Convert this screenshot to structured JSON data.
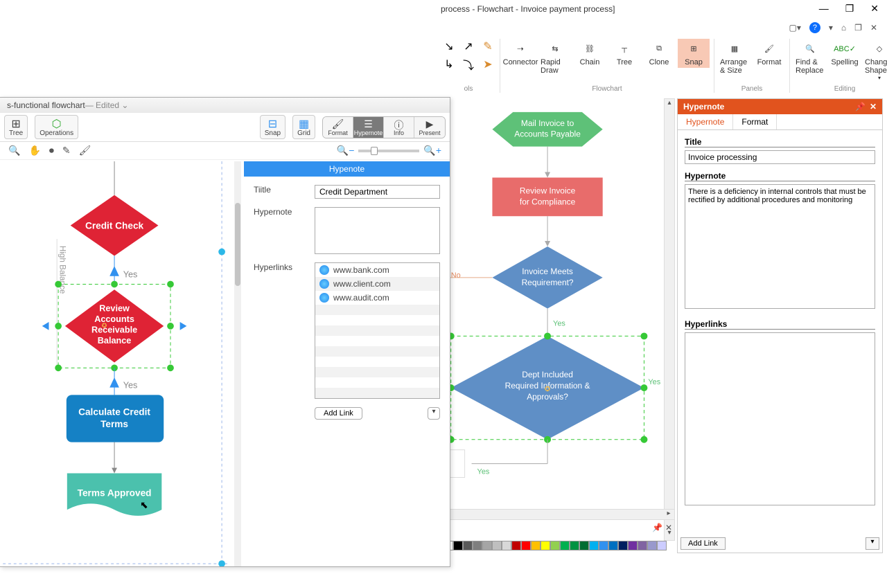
{
  "window": {
    "title": "process - Flowchart - Invoice payment process]",
    "controls": {
      "min": "—",
      "max": "❐",
      "close": "✕"
    },
    "quick": {
      "dd": "▾",
      "help": "?",
      "aux1": "▾",
      "aux2": "⌂",
      "aux3": "❐",
      "aux4": "✕"
    }
  },
  "ribbon": {
    "group1_label": "ols",
    "connector": "Connector",
    "rapid": "Rapid Draw",
    "chain": "Chain",
    "tree": "Tree",
    "clone": "Clone",
    "snap": "Snap",
    "flowchart_label": "Flowchart",
    "arrange": "Arrange & Size",
    "format": "Format",
    "panels_label": "Panels",
    "find": "Find & Replace",
    "spelling": "Spelling",
    "change_shape": "Change Shape",
    "editing_label": "Editing"
  },
  "hypernote_panel": {
    "header": "Hypernote",
    "tabs": {
      "hypernote": "Hypernote",
      "format": "Format"
    },
    "title_label": "Title",
    "title_value": "Invoice processing",
    "note_label": "Hypernote",
    "note_value": "There is a deficiency in internal controls that must be rectified by additional procedures and monitoring",
    "links_label": "Hyperlinks",
    "add_link": "Add Link"
  },
  "center_flow": {
    "node1": "Mail Invoice to Accounts Payable",
    "node2": "Review Invoice for Compliance",
    "node3": "Invoice Meets Requirement?",
    "node4": "Dept Included Required Information & Approvals?",
    "edge_no": "No",
    "edge_yes": "Yes",
    "edge_yes2": "Yes",
    "edge_yes3": "Yes"
  },
  "mac": {
    "doc_title": "s-functional flowchart",
    "edited": " — Edited",
    "tree": "Tree",
    "operations": "Operations",
    "snap": "Snap",
    "grid": "Grid",
    "seg_format": "Format",
    "seg_hypernote": "Hypernote",
    "seg_info": "Info",
    "seg_present": "Present",
    "inspector": {
      "header": "Hypenote",
      "title_label": "Tiitle",
      "title_value": "Credit Department",
      "note_label": "Hypernote",
      "links_label": "Hyperlinks",
      "link1": "www.bank.com",
      "link2": "www.client.com",
      "link3": "www.audit.com",
      "add_link": "Add Link"
    },
    "flow": {
      "credit_check": "Credit Check",
      "review": "Review Accounts Receivable Balance",
      "calc": "Calculate Credit Terms",
      "approved": "Terms Approved",
      "yes1": "Yes",
      "yes2": "Yes",
      "lane": "High Balance"
    }
  },
  "palette_colors": [
    "#ffffff",
    "#000000",
    "#595959",
    "#7f7f7f",
    "#a5a5a5",
    "#bfbfbf",
    "#d8d8d8",
    "#c00000",
    "#ff0000",
    "#ffc000",
    "#ffff00",
    "#92d050",
    "#00b050",
    "#009242",
    "#006d32",
    "#00b0f0",
    "#3191ef",
    "#0070c0",
    "#002060",
    "#7030a0",
    "#8064a2",
    "#9999cc",
    "#ccccff"
  ]
}
